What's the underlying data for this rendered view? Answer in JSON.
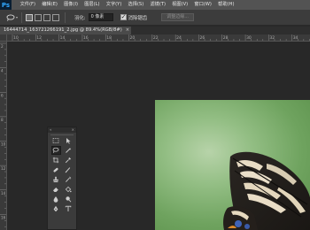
{
  "app": {
    "logo": "Ps"
  },
  "menu": [
    "文件(F)",
    "编辑(E)",
    "图像(I)",
    "图层(L)",
    "文字(Y)",
    "选择(S)",
    "滤镜(T)",
    "视图(V)",
    "窗口(W)",
    "帮助(H)"
  ],
  "options": {
    "feather_label": "羽化:",
    "feather_value": "0 像素",
    "antialias_label": "消除锯齿",
    "antialias_checked": true,
    "refine_edge_label": "调整边缘..."
  },
  "document": {
    "tab_title": "16444714_163721266191_2.jpg @ 89.4%(RGB/8#)",
    "close": "×"
  },
  "ruler": {
    "top_ticks": [
      "10",
      "12",
      "14",
      "16",
      "18",
      "20",
      "22",
      "24",
      "26",
      "28",
      "30",
      "32",
      "34"
    ],
    "left_ticks": [
      "2",
      "4",
      "6",
      "8",
      "10",
      "12",
      "14",
      "16"
    ]
  },
  "tools_panel": {
    "expand": "«",
    "close": "×",
    "selected_tool": "lasso-tool"
  },
  "colors": {
    "menubar": "#535353",
    "optionsbar": "#3c3c3c",
    "workspace": "#282828",
    "accent": "#31a8ff",
    "image_green": "#8cba7c"
  }
}
